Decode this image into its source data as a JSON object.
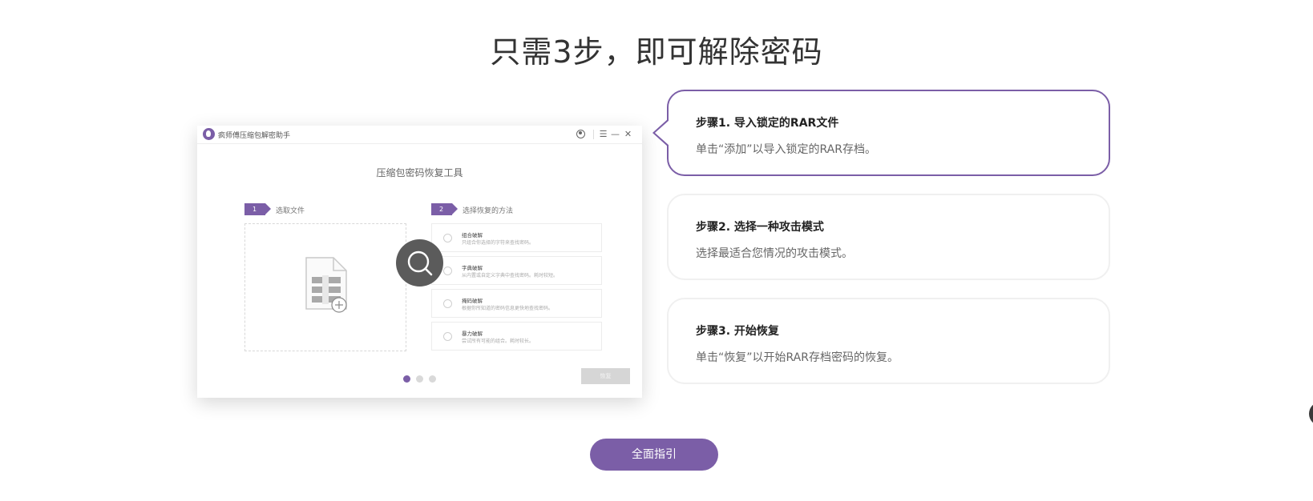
{
  "page": {
    "title": "只需3步，即可解除密码",
    "guide_button": "全面指引"
  },
  "app": {
    "name": "疯师傅压缩包解密助手",
    "heading": "压缩包密码恢复工具",
    "step1": {
      "num": "1",
      "label": "选取文件"
    },
    "step2": {
      "num": "2",
      "label": "选择恢复的方法"
    },
    "methods": [
      {
        "title": "组合破解",
        "desc": "只组合你选择的字符来查找密码。"
      },
      {
        "title": "字典破解",
        "desc": "从内置或自定义字典中查找密码。耗时较短。"
      },
      {
        "title": "掩码破解",
        "desc": "根据你所知道的密码信息更快地查找密码。"
      },
      {
        "title": "暴力破解",
        "desc": "尝试所有可能的组合。耗时较长。"
      }
    ],
    "recover_button": "恢复",
    "colors": {
      "accent": "#7b5ea7"
    }
  },
  "steps": [
    {
      "title": "步骤1. 导入锁定的RAR文件",
      "desc": "单击“添加”以导入锁定的RAR存档。"
    },
    {
      "title": "步骤2. 选择一种攻击模式",
      "desc": "选择最适合您情况的攻击模式。"
    },
    {
      "title": "步骤3. 开始恢复",
      "desc": "单击“恢复”以开始RAR存档密码的恢复。"
    }
  ]
}
